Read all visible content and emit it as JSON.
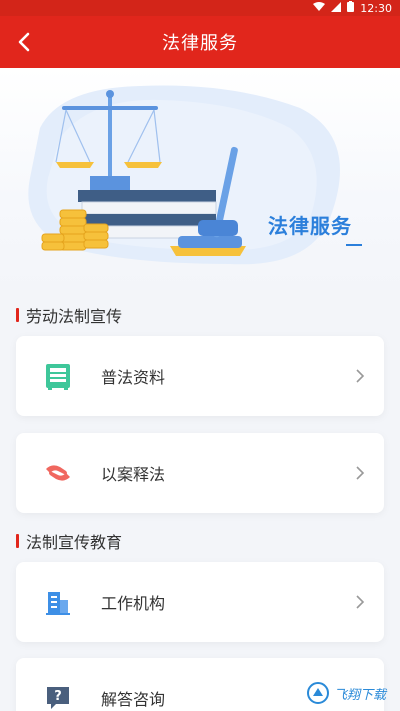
{
  "status_bar": {
    "time": "12:30",
    "icons": [
      "wifi-icon",
      "signal-icon",
      "battery-icon"
    ]
  },
  "app_bar": {
    "title": "法律服务",
    "back_icon": "chevron-left-icon"
  },
  "hero": {
    "title": "法律服务"
  },
  "sections": [
    {
      "heading": "劳动法制宣传"
    },
    {
      "heading": "法制宣传教育"
    }
  ],
  "cards": [
    {
      "label": "普法资料",
      "icon": "document-cabinet-icon",
      "color": "#3ec79a"
    },
    {
      "label": "以案释法",
      "icon": "handshake-icon",
      "color": "#f0675f"
    },
    {
      "label": "工作机构",
      "icon": "building-icon",
      "color": "#3d8fe6"
    },
    {
      "label": "解答咨询",
      "icon": "question-bubble-icon",
      "color": "#4a5f7d"
    }
  ],
  "watermark": {
    "text": "飞翔下载"
  },
  "colors": {
    "primary": "#e1261c",
    "accent_blue": "#2b7fdb"
  }
}
